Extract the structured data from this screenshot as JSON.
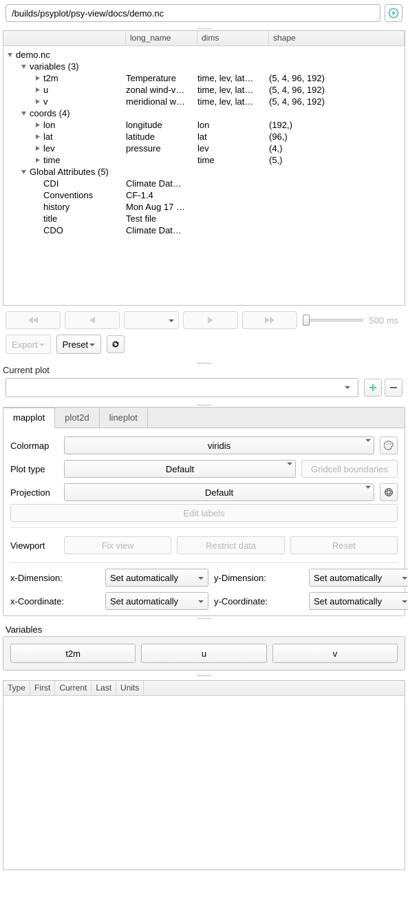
{
  "path": "/builds/psyplot/psy-view/docs/demo.nc",
  "tree": {
    "columns": [
      "",
      "long_name",
      "dims",
      "shape"
    ],
    "root": "demo.nc",
    "groups": [
      {
        "label": "variables (3)",
        "rows": [
          {
            "name": "t2m",
            "long": "Temperature",
            "dims": "time, lev, lat…",
            "shape": "(5, 4, 96, 192)"
          },
          {
            "name": "u",
            "long": "zonal wind-v…",
            "dims": "time, lev, lat…",
            "shape": "(5, 4, 96, 192)"
          },
          {
            "name": "v",
            "long": "meridional w…",
            "dims": "time, lev, lat…",
            "shape": "(5, 4, 96, 192)"
          }
        ]
      },
      {
        "label": "coords (4)",
        "rows": [
          {
            "name": "lon",
            "long": "longitude",
            "dims": "lon",
            "shape": "(192,)"
          },
          {
            "name": "lat",
            "long": "latitude",
            "dims": "lat",
            "shape": "(96,)"
          },
          {
            "name": "lev",
            "long": "pressure",
            "dims": "lev",
            "shape": "(4,)"
          },
          {
            "name": "time",
            "long": "",
            "dims": "time",
            "shape": "(5,)"
          }
        ]
      },
      {
        "label": "Global Attributes (5)",
        "attrs": [
          {
            "name": "CDI",
            "val": "Climate Dat…"
          },
          {
            "name": "Conventions",
            "val": "CF-1.4"
          },
          {
            "name": "history",
            "val": "Mon Aug 17 …"
          },
          {
            "name": "title",
            "val": "Test file"
          },
          {
            "name": "CDO",
            "val": "Climate Dat…"
          }
        ]
      }
    ]
  },
  "playback": {
    "interval": "500 ms"
  },
  "buttons": {
    "export": "Export",
    "preset": "Preset"
  },
  "current_plot": {
    "label": "Current plot"
  },
  "tabs": [
    "mapplot",
    "plot2d",
    "lineplot"
  ],
  "mapplot": {
    "colormap_label": "Colormap",
    "colormap": "viridis",
    "plot_type_label": "Plot type",
    "plot_type": "Default",
    "gridcell": "Gridcell boundaries",
    "projection_label": "Projection",
    "projection": "Default",
    "edit_labels": "Edit labels",
    "viewport_label": "Viewport",
    "fix_view": "Fix view",
    "restrict": "Restrict data",
    "reset": "Reset",
    "xdim_label": "x-Dimension:",
    "ydim_label": "y-Dimension:",
    "xcoord_label": "x-Coordinate:",
    "ycoord_label": "y-Coordinate:",
    "set_auto": "Set automatically"
  },
  "variables": {
    "label": "Variables",
    "items": [
      "t2m",
      "u",
      "v"
    ]
  },
  "bottom_cols": [
    "Type",
    "First",
    "Current",
    "Last",
    "Units"
  ]
}
